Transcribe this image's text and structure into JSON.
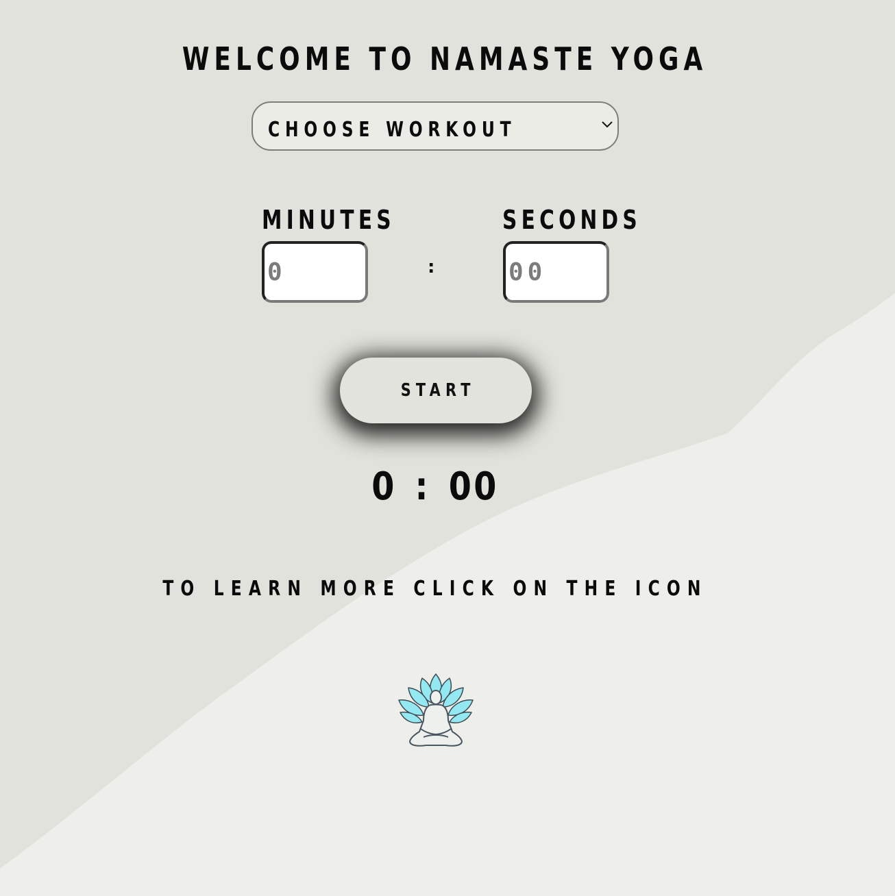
{
  "header": {
    "title": "WELCOME TO NAMASTE YOGA"
  },
  "workout_select": {
    "selected": "CHOOSE WORKOUT",
    "icon": "chevron-down-icon"
  },
  "timer_inputs": {
    "minutes_label": "MINUTES",
    "seconds_label": "SECONDS",
    "minutes_placeholder": "0",
    "seconds_placeholder": "00",
    "separator": ":"
  },
  "controls": {
    "start_label": "START"
  },
  "countdown": {
    "display": "0 : 00"
  },
  "learn_more": {
    "text": "TO LEARN MORE CLICK ON THE ICON",
    "icon": "meditation-lotus-icon"
  },
  "colors": {
    "background_upper": "#e2e2dd",
    "background_lower": "#eeeeea",
    "text": "#0b0b0b",
    "lotus_accent": "#8fe6ef",
    "figure_outline": "#5a6670"
  }
}
